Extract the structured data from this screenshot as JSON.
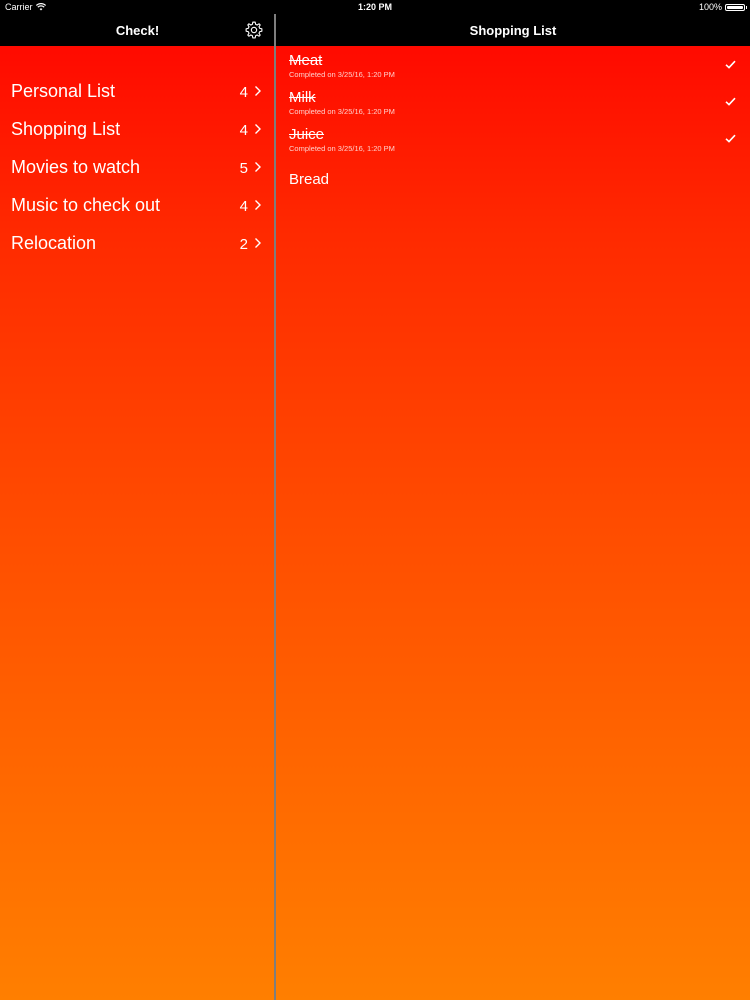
{
  "status_bar": {
    "carrier": "Carrier",
    "time": "1:20 PM",
    "battery": "100%"
  },
  "left_nav": {
    "title": "Check!",
    "settings_icon": "gear-icon"
  },
  "right_nav": {
    "title": "Shopping List"
  },
  "lists": [
    {
      "name": "Personal List",
      "count": "4"
    },
    {
      "name": "Shopping List",
      "count": "4"
    },
    {
      "name": "Movies to watch",
      "count": "5"
    },
    {
      "name": "Music to check out",
      "count": "4"
    },
    {
      "name": "Relocation",
      "count": "2"
    }
  ],
  "items": [
    {
      "name": "Meat",
      "completed": true,
      "meta": "Completed on 3/25/16, 1:20 PM"
    },
    {
      "name": "Milk",
      "completed": true,
      "meta": "Completed on 3/25/16, 1:20 PM"
    },
    {
      "name": "Juice",
      "completed": true,
      "meta": "Completed on 3/25/16, 1:20 PM"
    },
    {
      "name": "Bread",
      "completed": false
    }
  ],
  "colors": {
    "gradient_top": "#ff0a00",
    "gradient_bottom": "#ff7f00",
    "bar_background": "#000000",
    "text": "#ffffff"
  }
}
